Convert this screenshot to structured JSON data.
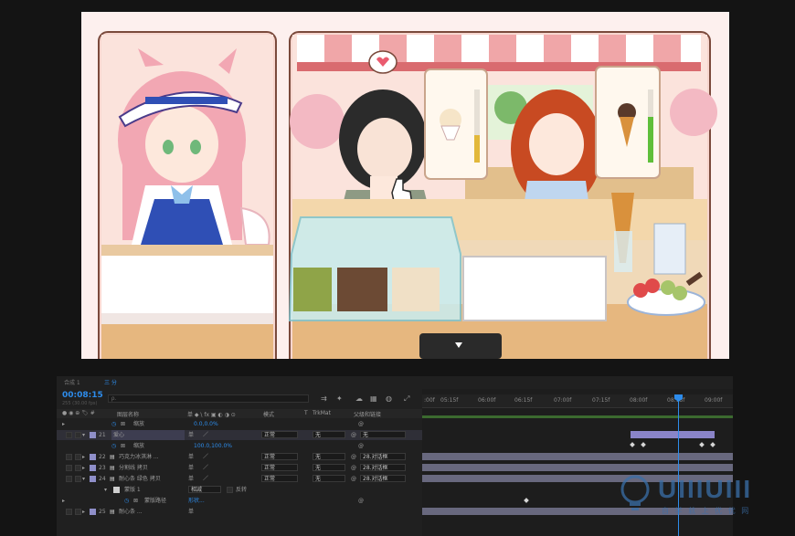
{
  "viewer": {
    "heart_icon": "heart-icon",
    "scoop_labels": [
      "matcha",
      "chocolate",
      "vanilla"
    ]
  },
  "timeline": {
    "tabs": [
      "合成 1",
      "三 分"
    ],
    "timecode": "00:08:15",
    "timecode_sub": "255 (30.00 fps)",
    "search_placeholder": "ρ.",
    "columns": {
      "layer_name": "图层名称",
      "switches": "单 ◆ \\ fx ▣ ◐ ◑ ⊙",
      "mode": "模式",
      "t": "T",
      "trkmat": "TrkMat",
      "parent": "父级和链接"
    },
    "ruler_ticks": [
      ":00f",
      "05:15f",
      "06:00f",
      "06:15f",
      "07:00f",
      "07:15f",
      "08:00f",
      "08:15f",
      "09:00f"
    ],
    "rows": [
      {
        "num": "",
        "name": "缩放",
        "value": "0.0,0.0%",
        "type": "prop"
      },
      {
        "num": "21",
        "name": "爱心",
        "switch": "单",
        "mode": "正常",
        "trkmat": "无",
        "parent": "无",
        "type": "layer",
        "selected": true
      },
      {
        "num": "",
        "name": "缩放",
        "value": "100.0,100.0%",
        "type": "prop"
      },
      {
        "num": "22",
        "name": "巧克力冰淇淋 ...",
        "switch": "单",
        "mode": "正常",
        "trkmat": "无",
        "parent": "28.对话框",
        "type": "layer"
      },
      {
        "num": "23",
        "name": "分割线 拷贝",
        "switch": "单",
        "mode": "正常",
        "trkmat": "无",
        "parent": "28.对话框",
        "type": "layer"
      },
      {
        "num": "24",
        "name": "耐心条 绿色 拷贝",
        "switch": "单",
        "mode": "正常",
        "trkmat": "无",
        "parent": "28.对话框",
        "type": "layer"
      },
      {
        "num": "",
        "name": "蒙版 1",
        "mode": "相减",
        "extra": "反转",
        "type": "mask"
      },
      {
        "num": "",
        "name": "蒙版路径",
        "value": "形状...",
        "type": "prop"
      },
      {
        "num": "25",
        "name": "耐心条 ...",
        "switch": "单",
        "type": "layer"
      }
    ]
  },
  "watermark": {
    "brand": "UIIIUIII",
    "tagline": "自 学 就 上 优 优 网"
  },
  "colors": {
    "accent_blue": "#2d8ceb",
    "layer_label": "#8f8fc9",
    "bar": "#68687e",
    "selected_bar": "#8a84c8"
  }
}
